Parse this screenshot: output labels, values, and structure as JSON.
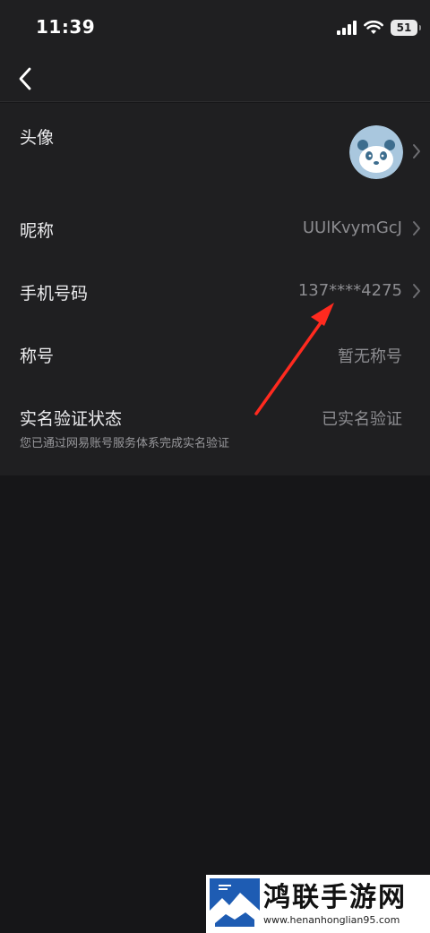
{
  "status_bar": {
    "time": "11:39",
    "battery": "51",
    "icons": [
      "signal-icon",
      "wifi-icon",
      "battery-icon"
    ]
  },
  "nav": {
    "back_icon": "chevron-left-icon"
  },
  "settings": {
    "avatar": {
      "label": "头像",
      "icon": "panda-avatar"
    },
    "nickname": {
      "label": "昵称",
      "value": "UUlKvymGcJ"
    },
    "phone": {
      "label": "手机号码",
      "value": "137****4275"
    },
    "title": {
      "label": "称号",
      "value": "暂无称号"
    },
    "verification": {
      "label": "实名验证状态",
      "value": "已实名验证",
      "note": "您已通过网易账号服务体系完成实名验证"
    }
  },
  "annotation": {
    "arrow_color": "#ff2a1f"
  },
  "watermark": {
    "title": "鸿联手游网",
    "url": "www.henanhonglian95.com"
  },
  "colors": {
    "background": "#161618",
    "panel": "#1f1f21",
    "label_text": "#ececee",
    "value_text": "#8c8c90"
  }
}
